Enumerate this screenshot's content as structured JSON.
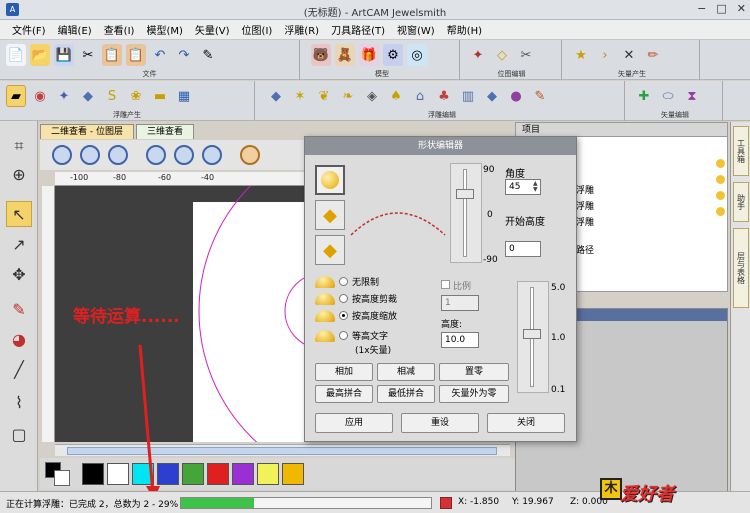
{
  "window": {
    "title": "(无标题) - ArtCAM Jewelsmith",
    "controls": [
      "−",
      "□",
      "✕"
    ]
  },
  "menu": [
    "文件(F)",
    "编辑(E)",
    "查看(I)",
    "模型(M)",
    "矢量(V)",
    "位图(I)",
    "浮雕(R)",
    "刀具路径(T)",
    "视窗(W)",
    "帮助(H)"
  ],
  "toolbars": {
    "file_caption": "文件",
    "model_caption": "模型",
    "bitmap_caption": "位图编辑",
    "vector_caption": "矢量产生",
    "relief_caption": "浮雕产生",
    "relief_edit_caption": "浮雕编辑",
    "vector_edit_caption": "矢量编辑"
  },
  "tabs": {
    "active": "二维查看 - 位图层",
    "inactive": "三维查看"
  },
  "ruler": {
    "ticks": [
      "-100",
      "-80",
      "-60",
      "-40"
    ]
  },
  "canvas": {
    "wait_text": "等待运算......"
  },
  "project_panel": {
    "title": "项目",
    "items": [
      "浮雕",
      "浮雕",
      "浮雕",
      "路径"
    ]
  },
  "right_tabs": [
    "工具箱",
    "助手",
    "层与表格"
  ],
  "dialog": {
    "title": "形状编辑器",
    "angle_label": "角度",
    "angle_value": "45",
    "start_height_label": "开始高度",
    "start_height_value": "0",
    "slider_max": "90",
    "slider_mid": "0",
    "slider_min": "-90",
    "radio_options": [
      "无限制",
      "按高度剪裁",
      "按高度缩放",
      "等高文字"
    ],
    "radio_selected_index": 2,
    "vector_count_note": "(1x矢量)",
    "scale_label": "比例",
    "scale_value": "1",
    "height_label": "高度:",
    "height_value": "10.0",
    "right_slider_top": "5.0",
    "right_slider_mid": "1.0",
    "right_slider_bottom": "0.1",
    "btn_add": "相加",
    "btn_subtract": "相减",
    "btn_zero": "置零",
    "btn_max_merge": "最高拼合",
    "btn_min_merge": "最低拼合",
    "btn_vector_zero": "矢量外为零",
    "btn_apply": "应用",
    "btn_reset": "重设",
    "btn_close": "关闭"
  },
  "palette": {
    "colors": [
      "#000000",
      "#ffffff",
      "#00e5f0",
      "#2d3fd0",
      "#46a53a",
      "#e02020",
      "#9b2fd6",
      "#f1f15a",
      "#f0b800"
    ]
  },
  "status": {
    "text": "正在计算浮雕：已完成 2，总数为 2 - 29%",
    "progress_percent": 29,
    "x": "X: -1.850",
    "y": "Y: 19.967",
    "z": "Z: 0.000"
  },
  "logo": {
    "text": "爱好者",
    "icon": "木"
  }
}
